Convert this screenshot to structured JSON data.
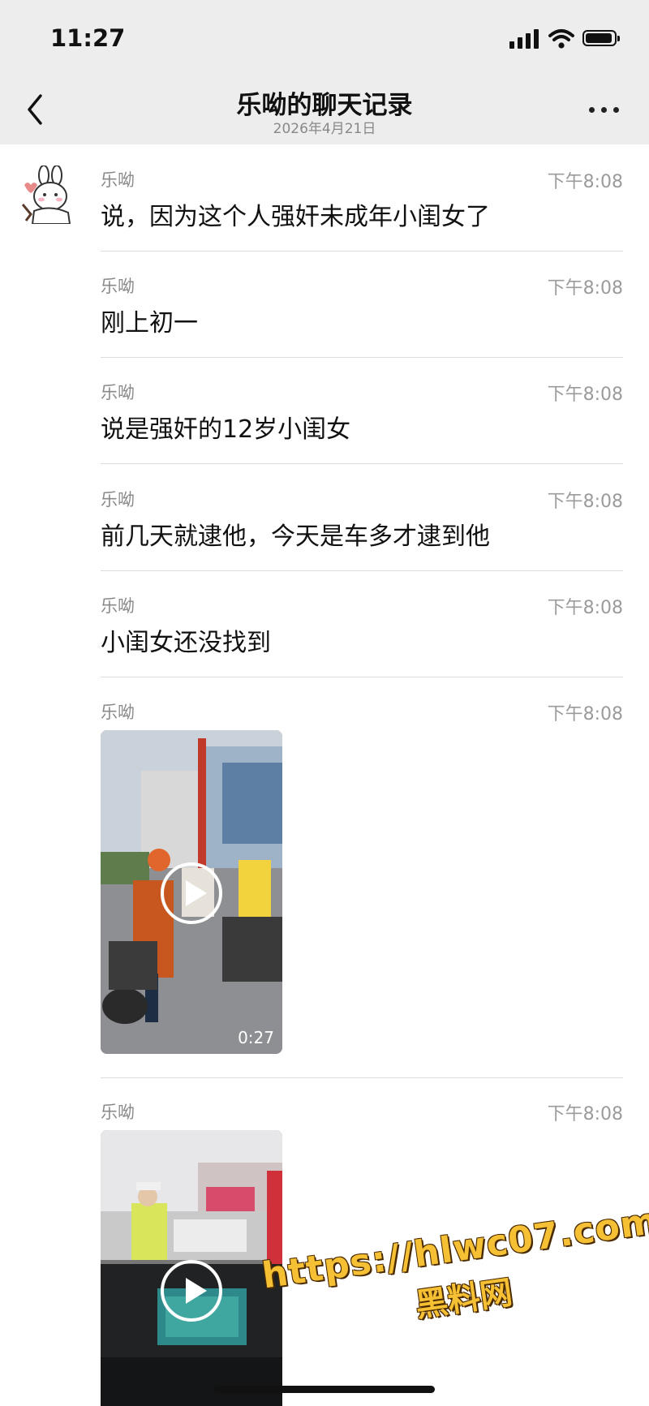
{
  "status_bar": {
    "time": "11:27",
    "icons": [
      "signal-icon",
      "wifi-icon",
      "battery-icon"
    ]
  },
  "nav": {
    "title": "乐呦的聊天记录",
    "subtitle": "2026年4月21日",
    "back_icon": "chevron-left-icon",
    "more_icon": "more-icon"
  },
  "messages": [
    {
      "sender": "乐呦",
      "time": "下午8:08",
      "type": "text",
      "text": "说，因为这个人强奸未成年小闺女了"
    },
    {
      "sender": "乐呦",
      "time": "下午8:08",
      "type": "text",
      "text": "刚上初一"
    },
    {
      "sender": "乐呦",
      "time": "下午8:08",
      "type": "text",
      "text": "说是强奸的12岁小闺女"
    },
    {
      "sender": "乐呦",
      "time": "下午8:08",
      "type": "text",
      "text": "前几天就逮他，今天是车多才逮到他"
    },
    {
      "sender": "乐呦",
      "time": "下午8:08",
      "type": "text",
      "text": "小闺女还没找到"
    },
    {
      "sender": "乐呦",
      "time": "下午8:08",
      "type": "video",
      "duration": "0:27"
    },
    {
      "sender": "乐呦",
      "time": "下午8:08",
      "type": "video",
      "duration": ""
    }
  ],
  "watermark": {
    "url": "https://hlwc07.com",
    "site": "黑料网"
  },
  "colors": {
    "topbar_bg": "#ededed",
    "watermark": "#f5c033"
  }
}
